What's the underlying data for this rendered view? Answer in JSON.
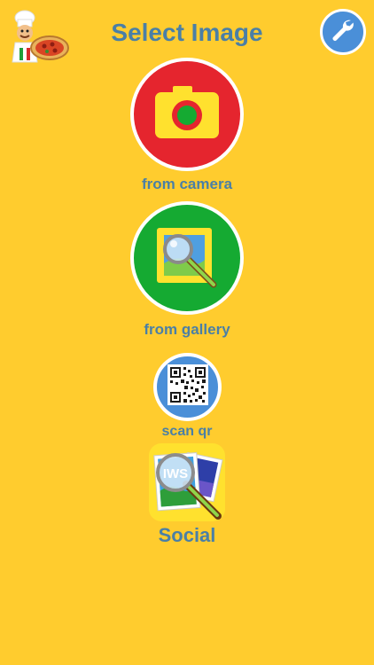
{
  "header": {
    "title": "Select Image",
    "logo_icon": "chef-pizza-logo-icon",
    "settings_icon": "wrench-icon"
  },
  "actions": {
    "camera": {
      "label": "from camera",
      "icon": "camera-icon",
      "color": "#E5252E"
    },
    "gallery": {
      "label": "from gallery",
      "icon": "gallery-search-icon",
      "color": "#15AA32"
    },
    "qr": {
      "label": "scan qr",
      "icon": "qr-code-icon",
      "color": "#4A8FD8"
    },
    "social": {
      "label": "Social",
      "badge": "IWS",
      "icon": "iws-social-icon"
    }
  },
  "colors": {
    "background": "#FFCC2E",
    "text": "#4A7FA6",
    "accent_blue": "#4A8FD8"
  }
}
